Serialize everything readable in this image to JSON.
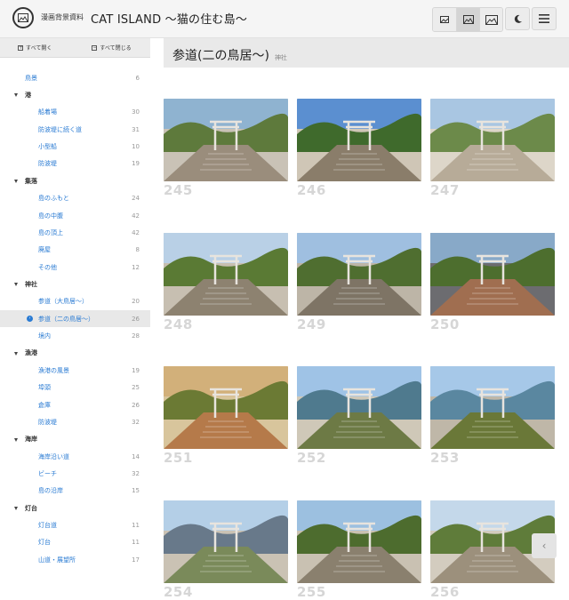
{
  "header": {
    "site_name": "漫画背景資料",
    "title": "CAT ISLAND 〜猫の住む島〜"
  },
  "sidebar": {
    "expand_all": "すべて開く",
    "collapse_all": "すべて閉じる",
    "rows": [
      {
        "type": "top",
        "label": "鳥景",
        "count": "6"
      },
      {
        "type": "cat",
        "label": "港"
      },
      {
        "type": "sub",
        "label": "船着場",
        "count": "30"
      },
      {
        "type": "sub",
        "label": "防波堤に続く道",
        "count": "31"
      },
      {
        "type": "sub",
        "label": "小型船",
        "count": "10"
      },
      {
        "type": "sub",
        "label": "防波堤",
        "count": "19"
      },
      {
        "type": "cat",
        "label": "集落"
      },
      {
        "type": "sub",
        "label": "島のふもと",
        "count": "24"
      },
      {
        "type": "sub",
        "label": "島の中腹",
        "count": "42"
      },
      {
        "type": "sub",
        "label": "島の頂上",
        "count": "42"
      },
      {
        "type": "sub",
        "label": "廃屋",
        "count": "8"
      },
      {
        "type": "sub",
        "label": "その他",
        "count": "12"
      },
      {
        "type": "cat",
        "label": "神社"
      },
      {
        "type": "sub",
        "label": "参道（大鳥居〜）",
        "count": "20"
      },
      {
        "type": "sub",
        "label": "参道（二の鳥居〜）",
        "count": "26",
        "selected": true
      },
      {
        "type": "sub",
        "label": "境内",
        "count": "28"
      },
      {
        "type": "cat",
        "label": "漁港"
      },
      {
        "type": "sub",
        "label": "漁港の風景",
        "count": "19"
      },
      {
        "type": "sub",
        "label": "埠頭",
        "count": "25"
      },
      {
        "type": "sub",
        "label": "倉庫",
        "count": "26"
      },
      {
        "type": "sub",
        "label": "防波堤",
        "count": "32"
      },
      {
        "type": "cat",
        "label": "海岸"
      },
      {
        "type": "sub",
        "label": "海岸沿い道",
        "count": "14"
      },
      {
        "type": "sub",
        "label": "ビーチ",
        "count": "32"
      },
      {
        "type": "sub",
        "label": "島の沿岸",
        "count": "15"
      },
      {
        "type": "cat",
        "label": "灯台"
      },
      {
        "type": "sub",
        "label": "灯台道",
        "count": "11"
      },
      {
        "type": "sub",
        "label": "灯台",
        "count": "11"
      },
      {
        "type": "sub",
        "label": "山道・展望所",
        "count": "17"
      }
    ]
  },
  "main": {
    "title": "参道(二の鳥居〜)",
    "tag": "神社",
    "photos": [
      {
        "number": "245",
        "palette": [
          "#8fb3d0",
          "#5e7a3c",
          "#9a8d7c",
          "#c9c2b6"
        ]
      },
      {
        "number": "246",
        "palette": [
          "#5b8fd0",
          "#3f6a2c",
          "#8a7d6a",
          "#cfc6b6"
        ]
      },
      {
        "number": "247",
        "palette": [
          "#a9c6e2",
          "#6c8a4a",
          "#b7ab98",
          "#ddd6c9"
        ]
      },
      {
        "number": "248",
        "palette": [
          "#b9d0e6",
          "#5a7a34",
          "#8d8270",
          "#c7bfb1"
        ]
      },
      {
        "number": "249",
        "palette": [
          "#9fbfe0",
          "#4f6e30",
          "#7e7465",
          "#bdb5a7"
        ]
      },
      {
        "number": "250",
        "palette": [
          "#88a9c8",
          "#4d6e2e",
          "#a06e50",
          "#6c6c70"
        ]
      },
      {
        "number": "251",
        "palette": [
          "#d2b07a",
          "#6b7a34",
          "#b57a4a",
          "#d8c59c"
        ]
      },
      {
        "number": "252",
        "palette": [
          "#9fc3e6",
          "#4f7a8e",
          "#6d7a45",
          "#cfc8b8"
        ]
      },
      {
        "number": "253",
        "palette": [
          "#a6c8e8",
          "#5a87a0",
          "#6a7838",
          "#bfb7a8"
        ]
      },
      {
        "number": "254",
        "palette": [
          "#b4cfe7",
          "#68798a",
          "#7a8a5a",
          "#cac2b4"
        ]
      },
      {
        "number": "255",
        "palette": [
          "#9cc0e0",
          "#4d6c2e",
          "#8a806e",
          "#c9c1b2"
        ]
      },
      {
        "number": "256",
        "palette": [
          "#c4d8ea",
          "#5f7c3a",
          "#9c907c",
          "#d3ccbf"
        ]
      }
    ]
  },
  "icons": {
    "logo": "landscape-logo-icon",
    "view_small": "image-small-icon",
    "view_medium": "image-medium-icon",
    "view_large": "image-large-icon",
    "dark_mode": "moon-icon",
    "menu": "hamburger-menu-icon",
    "scroll_left": "chevron-left-icon"
  },
  "colors": {
    "accent": "#2a7bd3",
    "number": "#d6d6d6"
  }
}
